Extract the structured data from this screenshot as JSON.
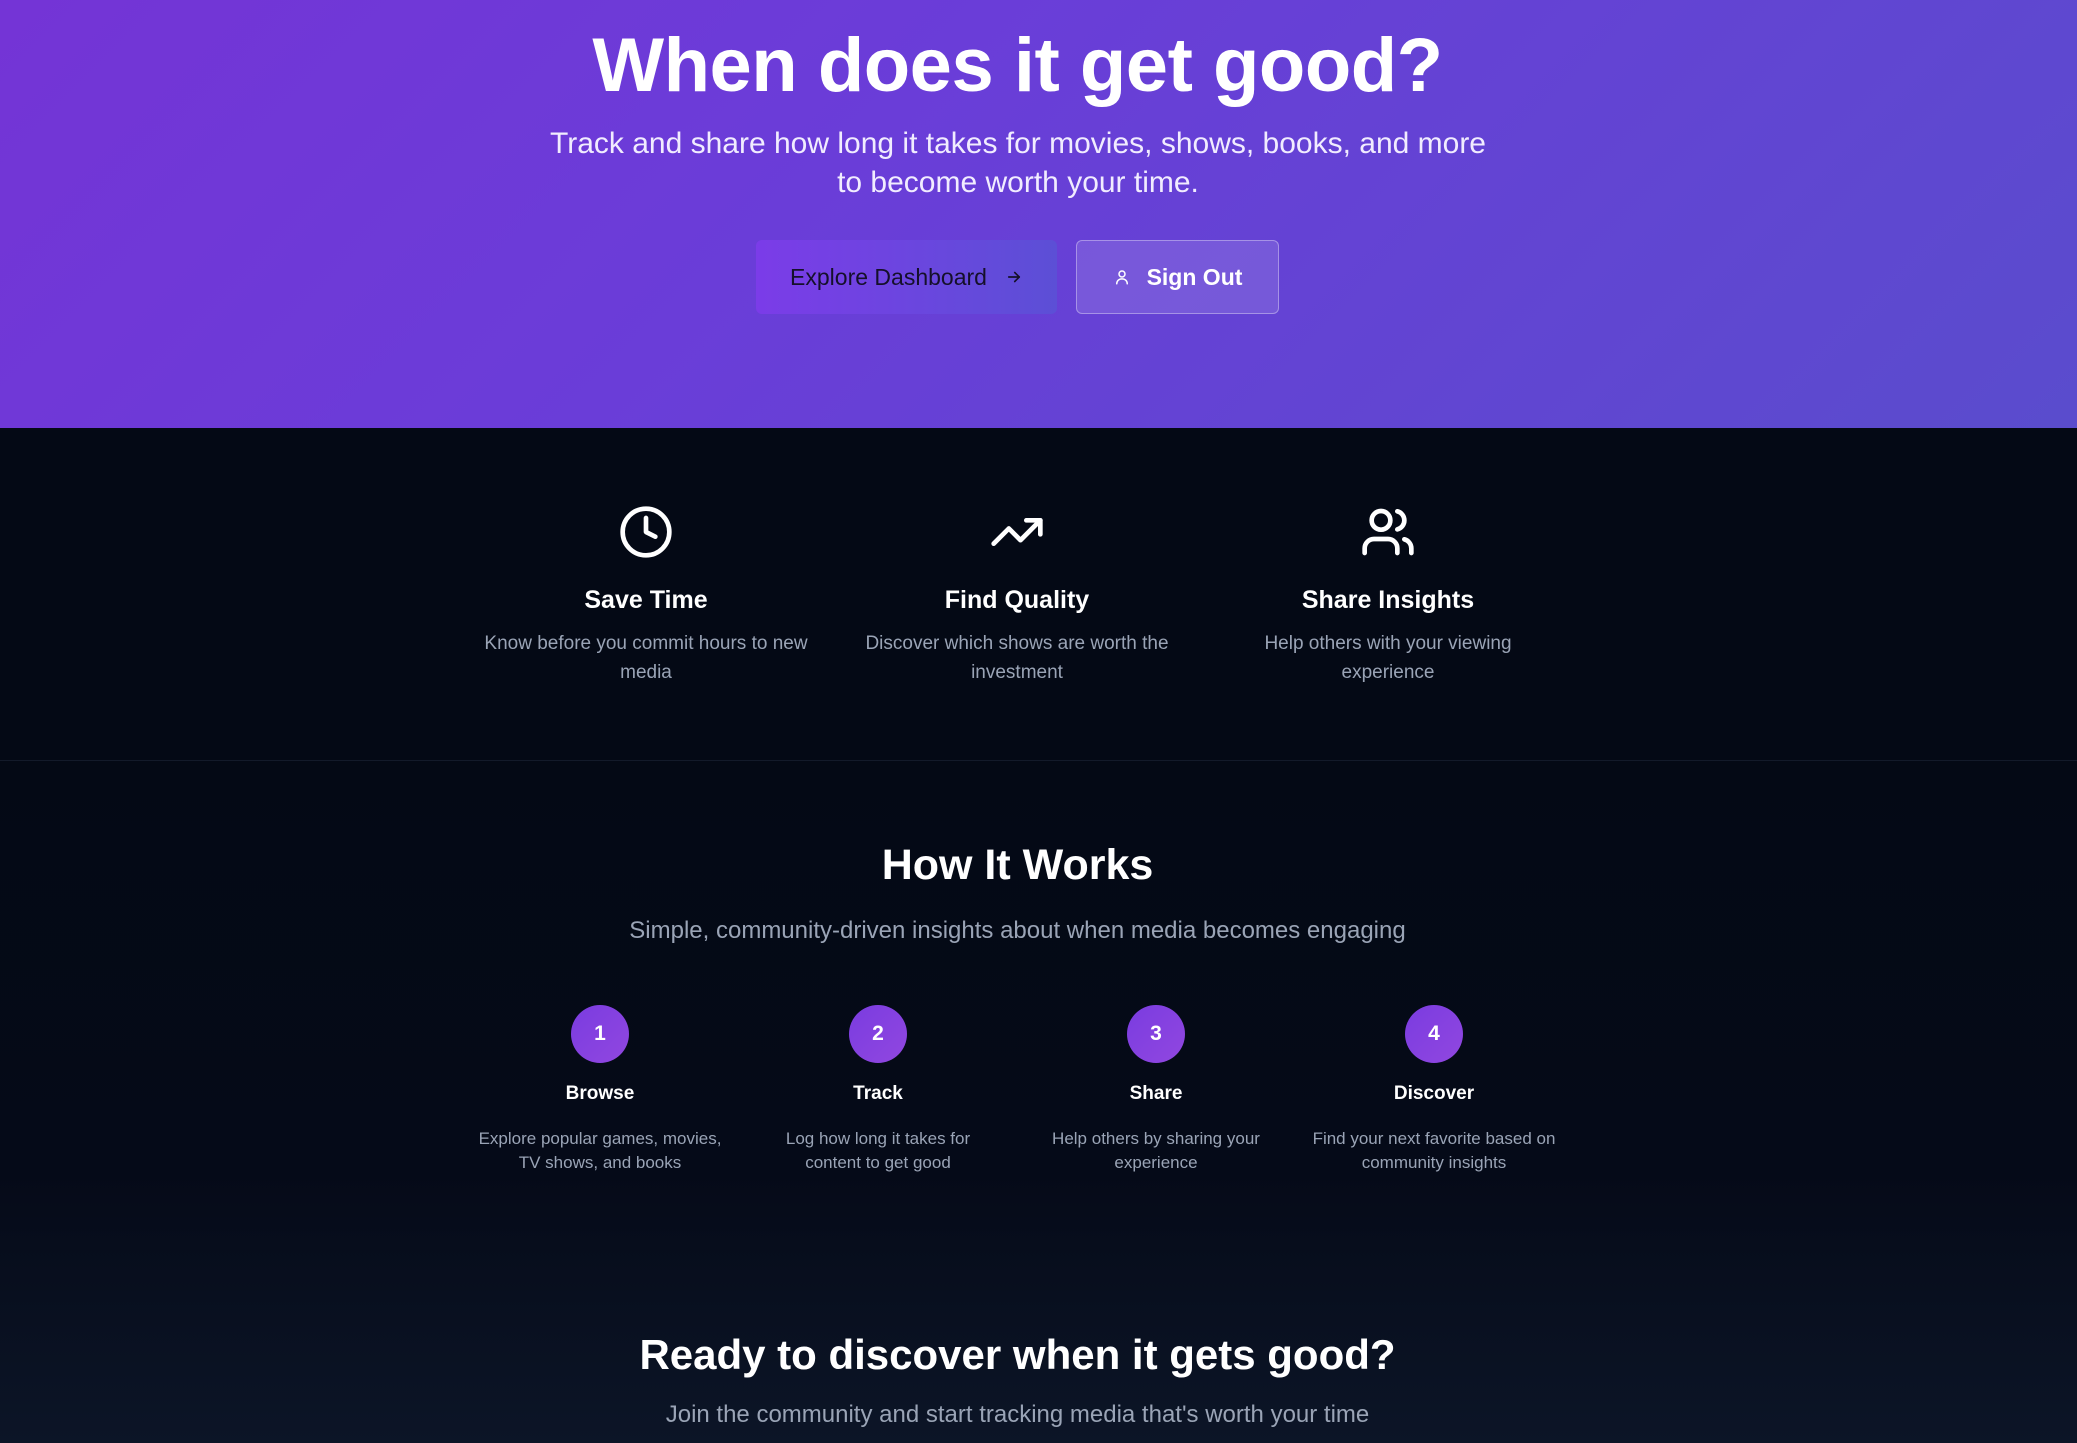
{
  "hero": {
    "title": "When does it get good?",
    "subtitle": "Track and share how long it takes for movies, shows, books, and more to become worth your time.",
    "explore_button": "Explore Dashboard",
    "signout_button": "Sign Out"
  },
  "features": [
    {
      "icon": "clock-icon",
      "title": "Save Time",
      "description": "Know before you commit hours to new media"
    },
    {
      "icon": "trending-up-icon",
      "title": "Find Quality",
      "description": "Discover which shows are worth the investment"
    },
    {
      "icon": "users-icon",
      "title": "Share Insights",
      "description": "Help others with your viewing experience"
    }
  ],
  "how_it_works": {
    "title": "How It Works",
    "subtitle": "Simple, community-driven insights about when media becomes engaging",
    "steps": [
      {
        "number": "1",
        "title": "Browse",
        "description": "Explore popular games, movies, TV shows, and books"
      },
      {
        "number": "2",
        "title": "Track",
        "description": "Log how long it takes for content to get good"
      },
      {
        "number": "3",
        "title": "Share",
        "description": "Help others by sharing your experience"
      },
      {
        "number": "4",
        "title": "Discover",
        "description": "Find your next favorite based on community insights"
      }
    ]
  },
  "cta": {
    "title": "Ready to discover when it gets good?",
    "subtitle": "Join the community and start tracking media that's worth your time"
  },
  "colors": {
    "hero_gradient_start": "#7434d6",
    "hero_gradient_end": "#5a4ccd",
    "background": "#050a18",
    "accent": "#7a3ce0",
    "muted_text": "#9aa4b6"
  }
}
